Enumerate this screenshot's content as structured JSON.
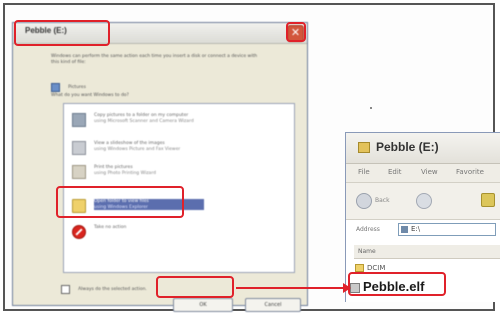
{
  "dialog": {
    "title": "Pebble (E:)",
    "close_label": "✕",
    "intro_text": "Windows can perform the same action each time you insert a disk or connect a device with this kind of file:",
    "content_type_label": "Pictures",
    "question": "What do you want Windows to do?",
    "options": [
      {
        "label": "Copy pictures to a folder on my computer",
        "sub": "using Microsoft Scanner and Camera Wizard",
        "icon": "copy-pictures-icon"
      },
      {
        "label": "View a slideshow of the images",
        "sub": "using Windows Picture and Fax Viewer",
        "icon": "slideshow-icon"
      },
      {
        "label": "Print the pictures",
        "sub": "using Photo Printing Wizard",
        "icon": "printer-icon"
      },
      {
        "label": "Open folder to view files",
        "sub": "using Windows Explorer",
        "icon": "folder-icon",
        "selected": true
      },
      {
        "label": "Take no action",
        "sub": "",
        "icon": "no-action-icon"
      }
    ],
    "always_label": "Always do the selected action.",
    "ok_label": "OK",
    "cancel_label": "Cancel"
  },
  "explorer": {
    "title": "Pebble (E:)",
    "menu": [
      "File",
      "Edit",
      "View",
      "Favorite"
    ],
    "back_label": "Back",
    "address_label": "Address",
    "address_value": "E:\\",
    "column_header": "Name",
    "files": [
      {
        "name": "DCIM"
      },
      {
        "name": "Pebble.elf"
      }
    ]
  },
  "annotations": {
    "color": "#e0212a"
  }
}
